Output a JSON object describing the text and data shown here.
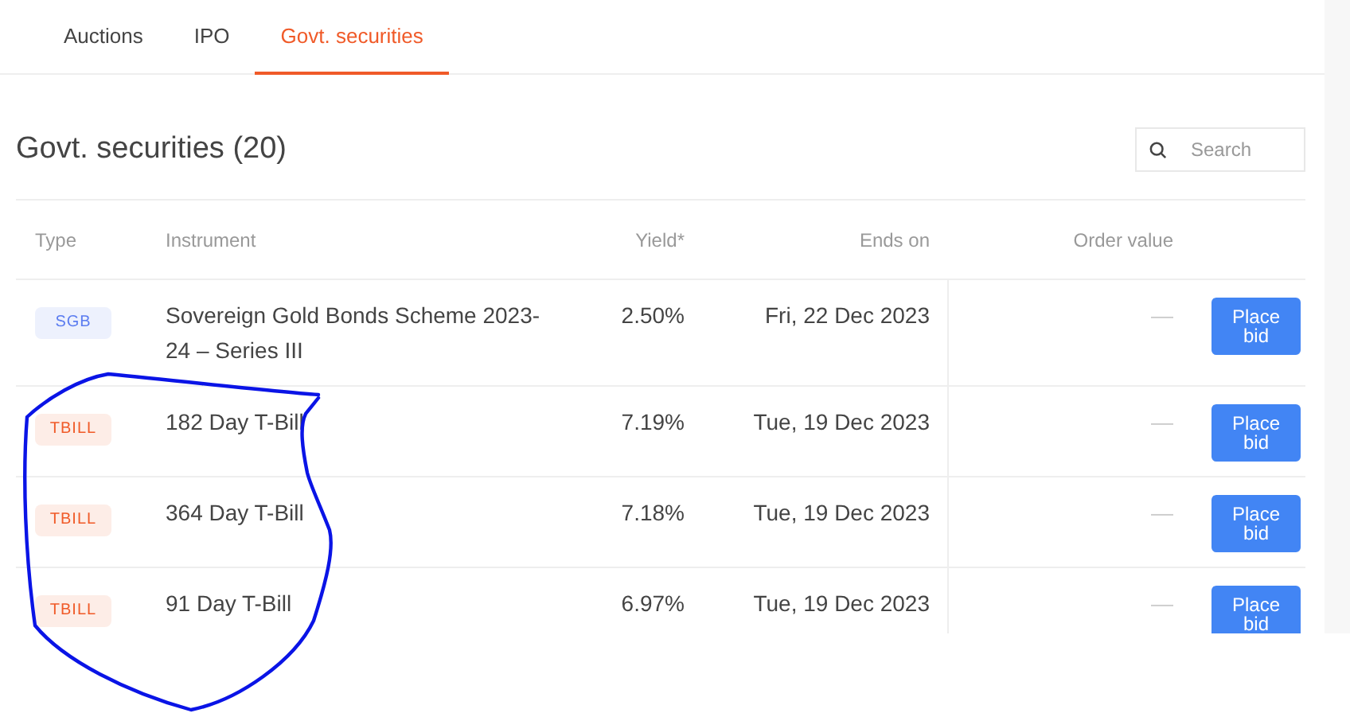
{
  "tabs": [
    {
      "label": "Auctions",
      "selected": false
    },
    {
      "label": "IPO",
      "selected": false
    },
    {
      "label": "Govt. securities",
      "selected": true
    }
  ],
  "title": "Govt. securities (20)",
  "search": {
    "placeholder": "Search"
  },
  "table": {
    "columns": [
      "Type",
      "Instrument",
      "Yield*",
      "Ends on",
      "Order value"
    ],
    "rows": [
      {
        "type": {
          "label": "SGB",
          "color": "#5b7cf0"
        },
        "instrument": "Sovereign Gold Bonds Scheme 2023-24 – Series III",
        "yield": "2.50%",
        "ends_on": "Fri, 22 Dec 2023",
        "order_value": "—",
        "action": "Place bid"
      },
      {
        "type": {
          "label": "TBILL",
          "color": "#f05a28"
        },
        "instrument": "182 Day T-Bill",
        "yield": "7.19%",
        "ends_on": "Tue, 19 Dec 2023",
        "order_value": "—",
        "action": "Place bid"
      },
      {
        "type": {
          "label": "TBILL",
          "color": "#f05a28"
        },
        "instrument": "364 Day T-Bill",
        "yield": "7.18%",
        "ends_on": "Tue, 19 Dec 2023",
        "order_value": "—",
        "action": "Place bid"
      },
      {
        "type": {
          "label": "TBILL",
          "color": "#f05a28"
        },
        "instrument": "91 Day T-Bill",
        "yield": "6.97%",
        "ends_on": "Tue, 19 Dec 2023",
        "order_value": "—",
        "action": "Place bid"
      }
    ]
  }
}
